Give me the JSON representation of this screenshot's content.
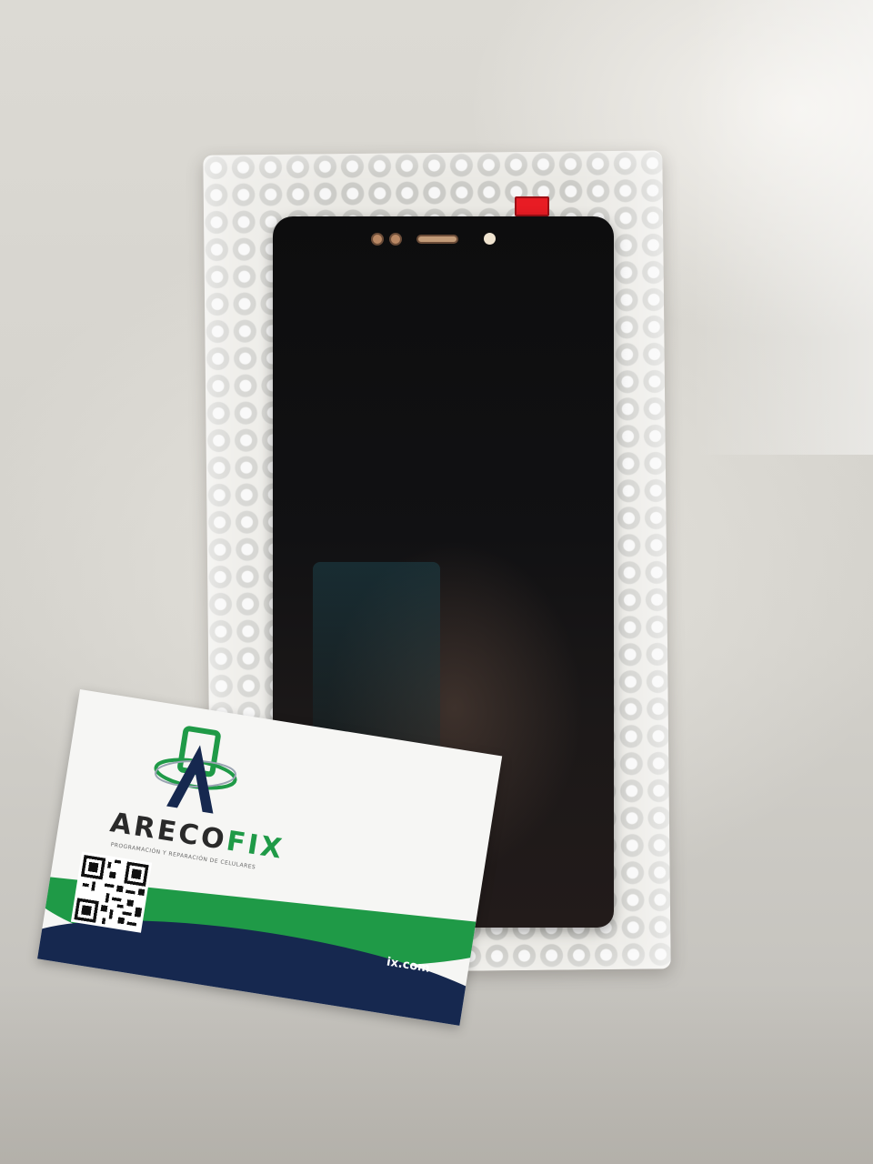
{
  "card": {
    "brand_main": "ARECO",
    "brand_accent": "FIX",
    "tagline": "PROGRAMACIÓN Y REPARACIÓN DE CELULARES",
    "website": "ix.com"
  },
  "colors": {
    "card_green": "#1f9a47",
    "card_navy": "#16284f",
    "protective_tab": "#e81c24",
    "screen_black": "#0d0d0e"
  }
}
